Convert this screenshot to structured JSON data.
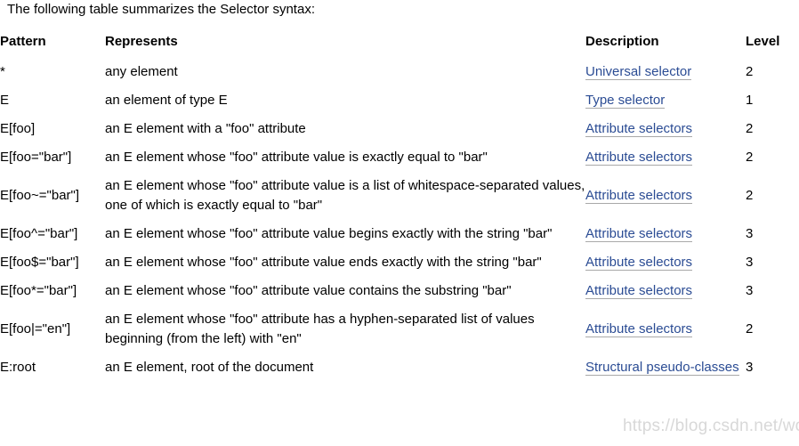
{
  "intro": "The following table summarizes the Selector syntax:",
  "table": {
    "headers": {
      "pattern": "Pattern",
      "represents": "Represents",
      "description": "Description",
      "level": "Level"
    },
    "rows": [
      {
        "pattern": "*",
        "represents": "any element",
        "description": "Universal selector",
        "level": "2"
      },
      {
        "pattern": "E",
        "represents": "an element of type E",
        "description": "Type selector",
        "level": "1"
      },
      {
        "pattern": "E[foo]",
        "represents": "an E element with a \"foo\" attribute",
        "description": "Attribute selectors",
        "level": "2"
      },
      {
        "pattern": "E[foo=\"bar\"]",
        "represents": "an E element whose \"foo\" attribute value is exactly equal to \"bar\"",
        "description": "Attribute selectors",
        "level": "2"
      },
      {
        "pattern": "E[foo~=\"bar\"]",
        "represents": "an E element whose \"foo\" attribute value is a list of whitespace-separated values, one of which is exactly equal to \"bar\"",
        "description": "Attribute selectors",
        "level": "2"
      },
      {
        "pattern": "E[foo^=\"bar\"]",
        "represents": "an E element whose \"foo\" attribute value begins exactly with the string \"bar\"",
        "description": "Attribute selectors",
        "level": "3"
      },
      {
        "pattern": "E[foo$=\"bar\"]",
        "represents": "an E element whose \"foo\" attribute value ends exactly with the string \"bar\"",
        "description": "Attribute selectors",
        "level": "3"
      },
      {
        "pattern": "E[foo*=\"bar\"]",
        "represents": "an E element whose \"foo\" attribute value contains the substring \"bar\"",
        "description": "Attribute selectors",
        "level": "3"
      },
      {
        "pattern": "E[foo|=\"en\"]",
        "represents": "an E element whose \"foo\" attribute has a hyphen-separated list of values beginning (from the left) with \"en\"",
        "description": "Attribute selectors",
        "level": "2"
      },
      {
        "pattern": "E:root",
        "represents": "an E element, root of the document",
        "description": "Structural pseudo-classes",
        "level": "3"
      }
    ]
  },
  "watermark": "https://blog.csdn.net/wo_sxn",
  "colors": {
    "link": "#2b4c94",
    "link_underline": "#a9a9a9",
    "text": "#000000",
    "background": "#ffffff",
    "watermark": "#d8d8d8"
  }
}
